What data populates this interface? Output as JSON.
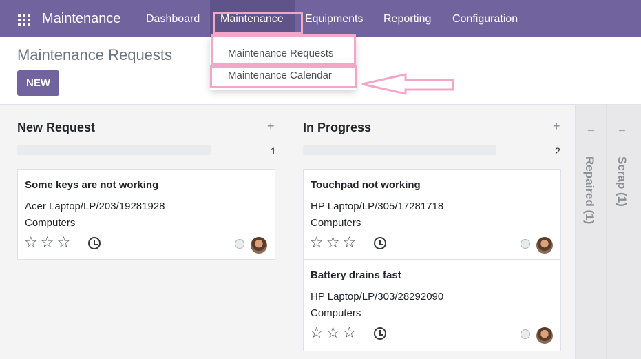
{
  "navbar": {
    "brand": "Maintenance",
    "items": [
      "Dashboard",
      "Maintenance",
      "Equipments",
      "Reporting",
      "Configuration"
    ]
  },
  "dropdown": {
    "items": [
      "Maintenance Requests",
      "Maintenance Calendar"
    ]
  },
  "control": {
    "title": "Maintenance Requests",
    "new_label": "NEW"
  },
  "kanban": {
    "columns": [
      {
        "name": "New Request",
        "count": "1",
        "cards": [
          {
            "title": "Some keys are not working",
            "equipment": "Acer Laptop/LP/203/19281928",
            "category": "Computers"
          }
        ]
      },
      {
        "name": "In Progress",
        "count": "2",
        "cards": [
          {
            "title": "Touchpad not working",
            "equipment": "HP Laptop/LP/305/17281718",
            "category": "Computers"
          },
          {
            "title": "Battery drains fast",
            "equipment": "HP Laptop/LP/303/28292090",
            "category": "Computers"
          }
        ]
      }
    ],
    "folded": [
      "Repaired (1)",
      "Scrap (1)"
    ]
  },
  "icons": {
    "plus": "+",
    "star": "☆",
    "fold": "↔"
  },
  "colors": {
    "brand": "#71639e",
    "highlight": "#f2a7c8"
  }
}
